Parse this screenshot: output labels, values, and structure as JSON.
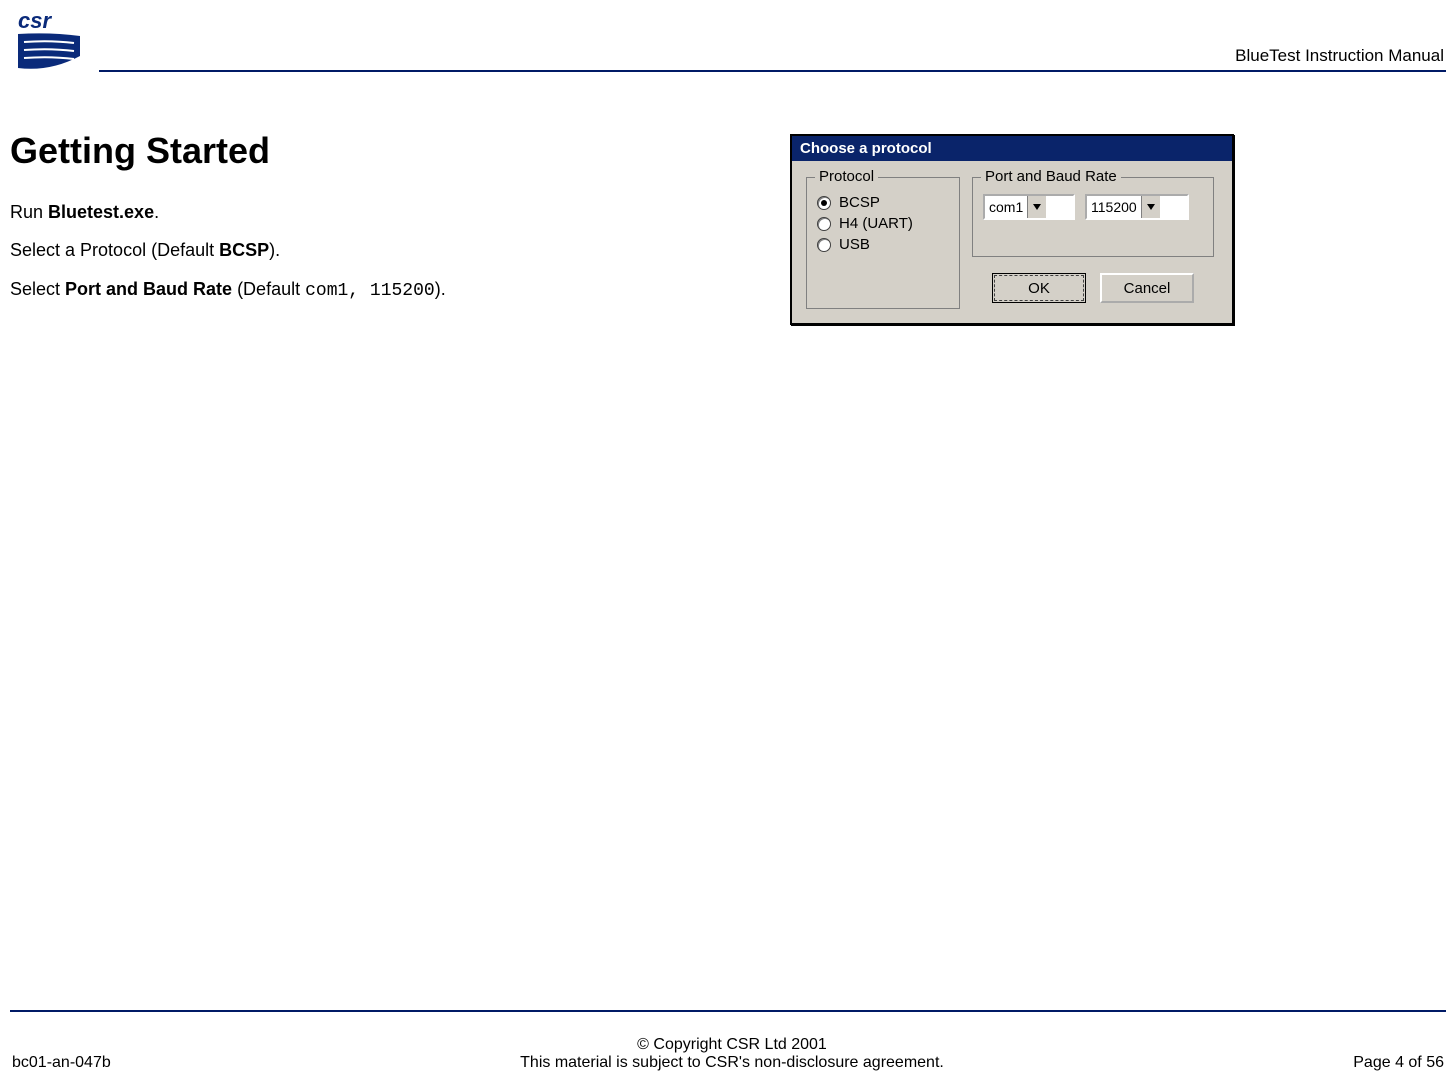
{
  "header": {
    "doc_title": "BlueTest Instruction Manual"
  },
  "body": {
    "heading": "Getting Started",
    "line1_pre": "Run ",
    "line1_bold": "Bluetest.exe",
    "line1_post": ".",
    "line2_pre": "Select a Protocol (Default ",
    "line2_bold": "BCSP",
    "line2_post": ").",
    "line3_pre": "Select ",
    "line3_bold": "Port and Baud Rate",
    "line3_mid": " (Default ",
    "line3_mono": "com1, 115200",
    "line3_post": ")."
  },
  "dialog": {
    "title": "Choose a protocol",
    "protocol_legend": "Protocol",
    "protocol_options": {
      "bcsp": "BCSP",
      "h4": "H4 (UART)",
      "usb": "USB"
    },
    "port_legend": "Port and Baud Rate",
    "port_value": "com1",
    "baud_value": "115200",
    "ok_label": "OK",
    "cancel_label": "Cancel"
  },
  "footer": {
    "doc_code": "bc01-an-047b",
    "copyright": "© Copyright CSR Ltd 2001",
    "nda": "This material is subject to CSR's non-disclosure agreement.",
    "page": "Page 4 of 56"
  }
}
